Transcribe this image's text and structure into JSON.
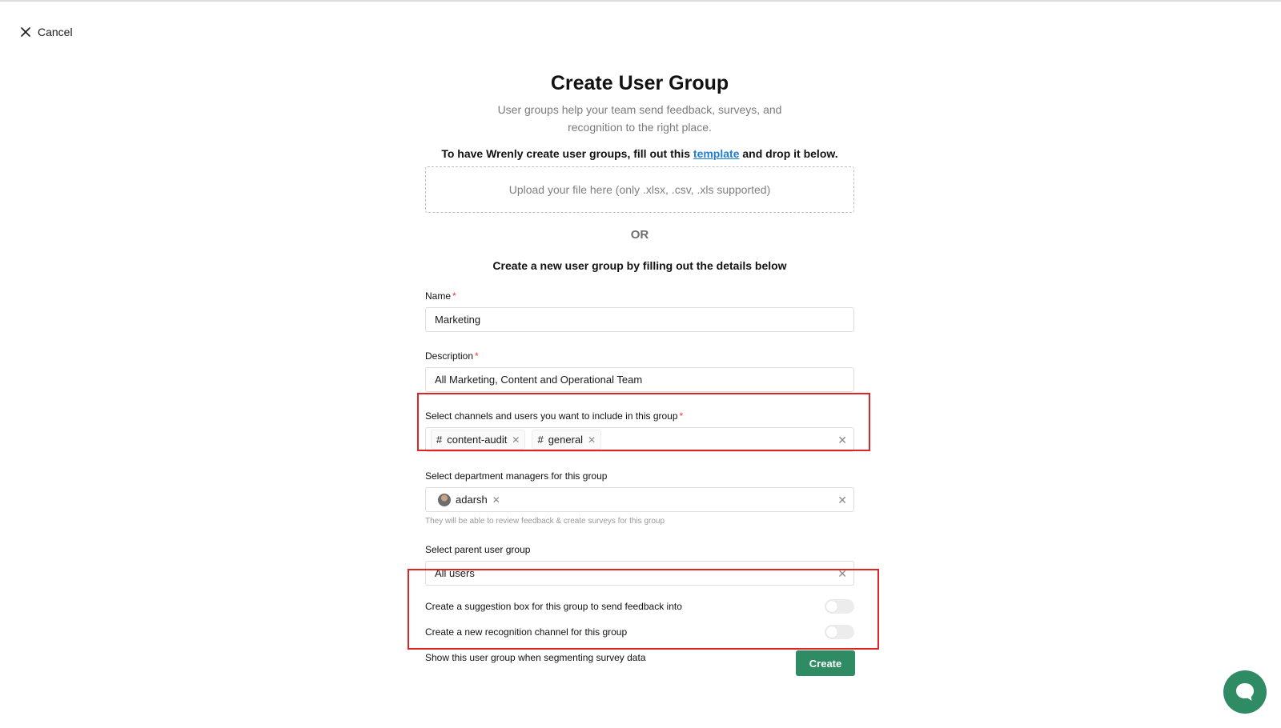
{
  "header": {
    "cancel_label": "Cancel"
  },
  "page": {
    "title": "Create User Group",
    "subtitle": "User groups help your team send feedback, surveys, and recognition to the right place.",
    "template_prefix": "To have Wrenly create user groups, fill out this ",
    "template_link": "template",
    "template_suffix": " and drop it below.",
    "upload_placeholder": "Upload your file here (only .xlsx, .csv, .xls supported)",
    "or_label": "OR",
    "manual_heading": "Create a new user group by filling out the details below"
  },
  "form": {
    "name": {
      "label": "Name",
      "required_mark": "*",
      "value": "Marketing"
    },
    "description": {
      "label": "Description",
      "required_mark": "*",
      "value": "All Marketing, Content and Operational Team"
    },
    "channels": {
      "label": "Select channels and users you want to include in this group",
      "required_mark": "*",
      "tags": [
        {
          "prefix": "#",
          "label": "content-audit"
        },
        {
          "prefix": "#",
          "label": "general"
        }
      ]
    },
    "managers": {
      "label": "Select department managers for this group",
      "tags": [
        {
          "label": "adarsh"
        }
      ],
      "hint": "They will be able to review feedback & create surveys for this group"
    },
    "parent": {
      "label": "Select parent user group",
      "value": "All users"
    },
    "toggles": [
      {
        "label": "Create a suggestion box for this group to send feedback into",
        "on": false
      },
      {
        "label": "Create a new recognition channel for this group",
        "on": false
      },
      {
        "label": "Show this user group when segmenting survey data",
        "on": true
      }
    ],
    "submit_label": "Create"
  },
  "icons": {
    "cancel": "close-icon",
    "tag_remove": "close-icon",
    "clear": "clear-icon",
    "chat": "chat-bubble-icon"
  },
  "colors": {
    "accent": "#2e8b63",
    "link": "#1e7ed6",
    "required": "#e53935",
    "highlight": "#e02424"
  }
}
